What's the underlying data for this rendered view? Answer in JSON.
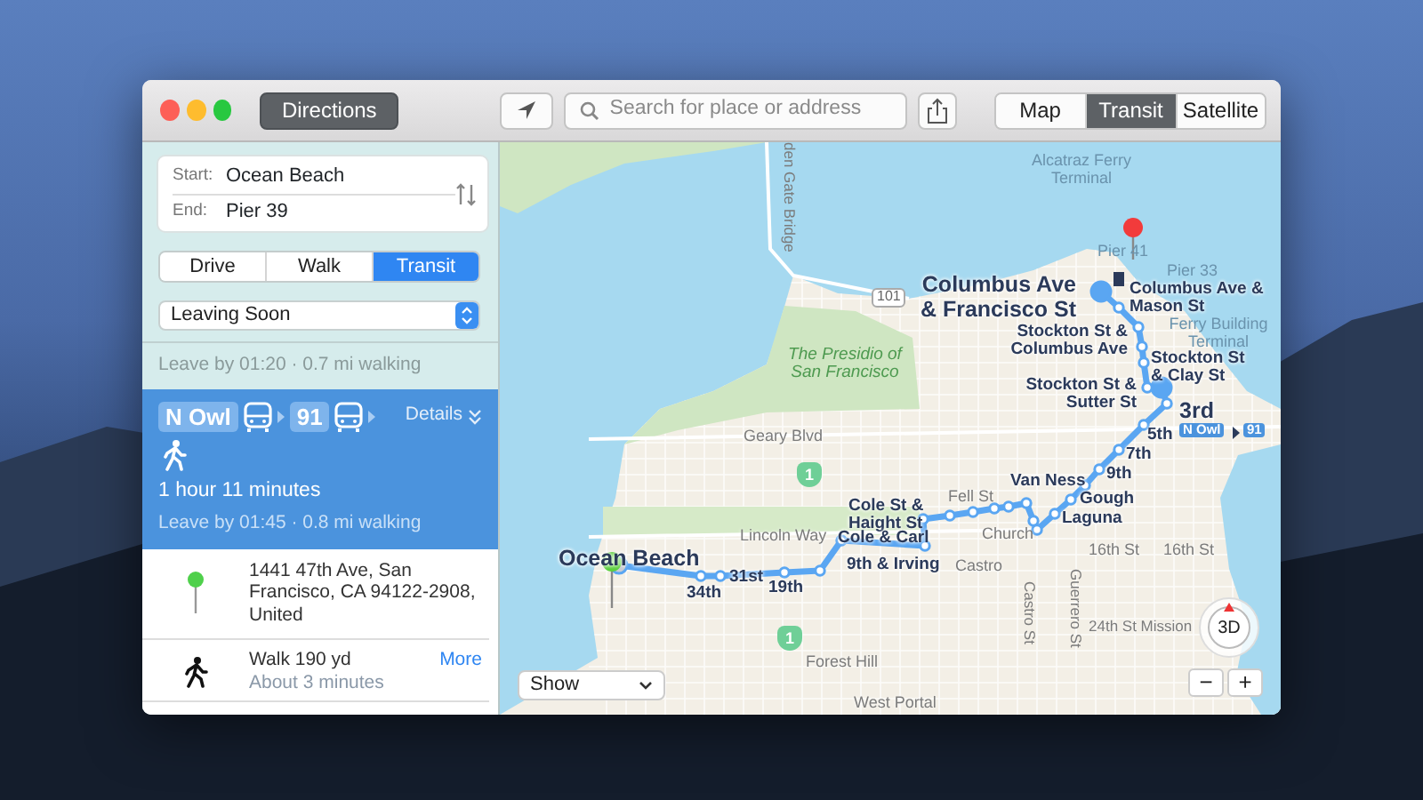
{
  "toolbar": {
    "directions_button": "Directions",
    "search": {
      "placeholder": "Search for place or address"
    },
    "map_modes": [
      {
        "label": "Map",
        "selected": false
      },
      {
        "label": "Transit",
        "selected": true
      },
      {
        "label": "Satellite",
        "selected": false
      }
    ]
  },
  "sidebar": {
    "start": {
      "label": "Start:",
      "value": "Ocean Beach"
    },
    "end": {
      "label": "End:",
      "value": "Pier 39"
    },
    "transport_modes": [
      {
        "label": "Drive",
        "selected": false
      },
      {
        "label": "Walk",
        "selected": false
      },
      {
        "label": "Transit",
        "selected": true
      }
    ],
    "departure": "Leaving Soon",
    "routes": [
      {
        "selected": false,
        "summary": "Leave by 01:20 · 0.7 mi walking"
      },
      {
        "selected": true,
        "lines": [
          "N Owl",
          "91"
        ],
        "details": "Details",
        "duration": "1 hour 11 minutes",
        "summary": "Leave by 01:45 · 0.8 mi walking"
      }
    ],
    "steps": [
      {
        "kind": "pin",
        "text": "1441 47th Ave, San Francisco, CA 94122-2908, United"
      },
      {
        "kind": "walk",
        "text": "Walk 190 yd",
        "subtext": "About 3 minutes",
        "link": "More"
      }
    ]
  },
  "map": {
    "labels": [
      {
        "text": "den Gate Bridge",
        "kind": "vertical"
      },
      {
        "text": "Alcatraz Ferry Terminal",
        "kind": "water"
      },
      {
        "text": "Pier 41",
        "kind": "water"
      },
      {
        "text": "Pier 33",
        "kind": "water"
      },
      {
        "text": "101",
        "kind": "highway"
      },
      {
        "text": "Columbus Ave & Francisco St",
        "kind": "major"
      },
      {
        "text": "Columbus Ave & Mason St",
        "kind": "stop"
      },
      {
        "text": "The Presidio of San Francisco",
        "kind": "park"
      },
      {
        "text": "Stockton St & Columbus Ave",
        "kind": "stop"
      },
      {
        "text": "Ferry Building Terminal",
        "kind": "water"
      },
      {
        "text": "Stockton St & Clay St",
        "kind": "stop"
      },
      {
        "text": "Stockton St & Sutter St",
        "kind": "stop"
      },
      {
        "text": "3rd",
        "kind": "major"
      },
      {
        "text": "Geary Blvd",
        "kind": "street"
      },
      {
        "text": "5th",
        "kind": "stop"
      },
      {
        "text": "N Owl",
        "kind": "badge"
      },
      {
        "text": "91",
        "kind": "badge"
      },
      {
        "text": "7th",
        "kind": "stop"
      },
      {
        "text": "1",
        "kind": "shield"
      },
      {
        "text": "Van Ness",
        "kind": "stop"
      },
      {
        "text": "9th",
        "kind": "stop"
      },
      {
        "text": "Cole St & Haight St",
        "kind": "stop"
      },
      {
        "text": "Fell St",
        "kind": "street"
      },
      {
        "text": "Gough",
        "kind": "stop"
      },
      {
        "text": "Laguna",
        "kind": "stop"
      },
      {
        "text": "Lincoln Way",
        "kind": "street"
      },
      {
        "text": "Cole & Carl",
        "kind": "stop"
      },
      {
        "text": "Church",
        "kind": "street"
      },
      {
        "text": "16th St",
        "kind": "street"
      },
      {
        "text": "16th St",
        "kind": "street"
      },
      {
        "text": "Ocean Beach",
        "kind": "major"
      },
      {
        "text": "9th & Irving",
        "kind": "stop"
      },
      {
        "text": "Castro",
        "kind": "street"
      },
      {
        "text": "34th",
        "kind": "stop"
      },
      {
        "text": "31st",
        "kind": "stop"
      },
      {
        "text": "19th",
        "kind": "stop"
      },
      {
        "text": "Castro St",
        "kind": "vertical"
      },
      {
        "text": "Guerrero St",
        "kind": "vertical"
      },
      {
        "text": "1",
        "kind": "shield"
      },
      {
        "text": "24th St Mission",
        "kind": "street"
      },
      {
        "text": "Forest Hill",
        "kind": "street"
      },
      {
        "text": "West Portal",
        "kind": "street"
      }
    ],
    "show_menu": "Show",
    "compass": "3D",
    "zoom_buttons": [
      "−",
      "+"
    ]
  }
}
